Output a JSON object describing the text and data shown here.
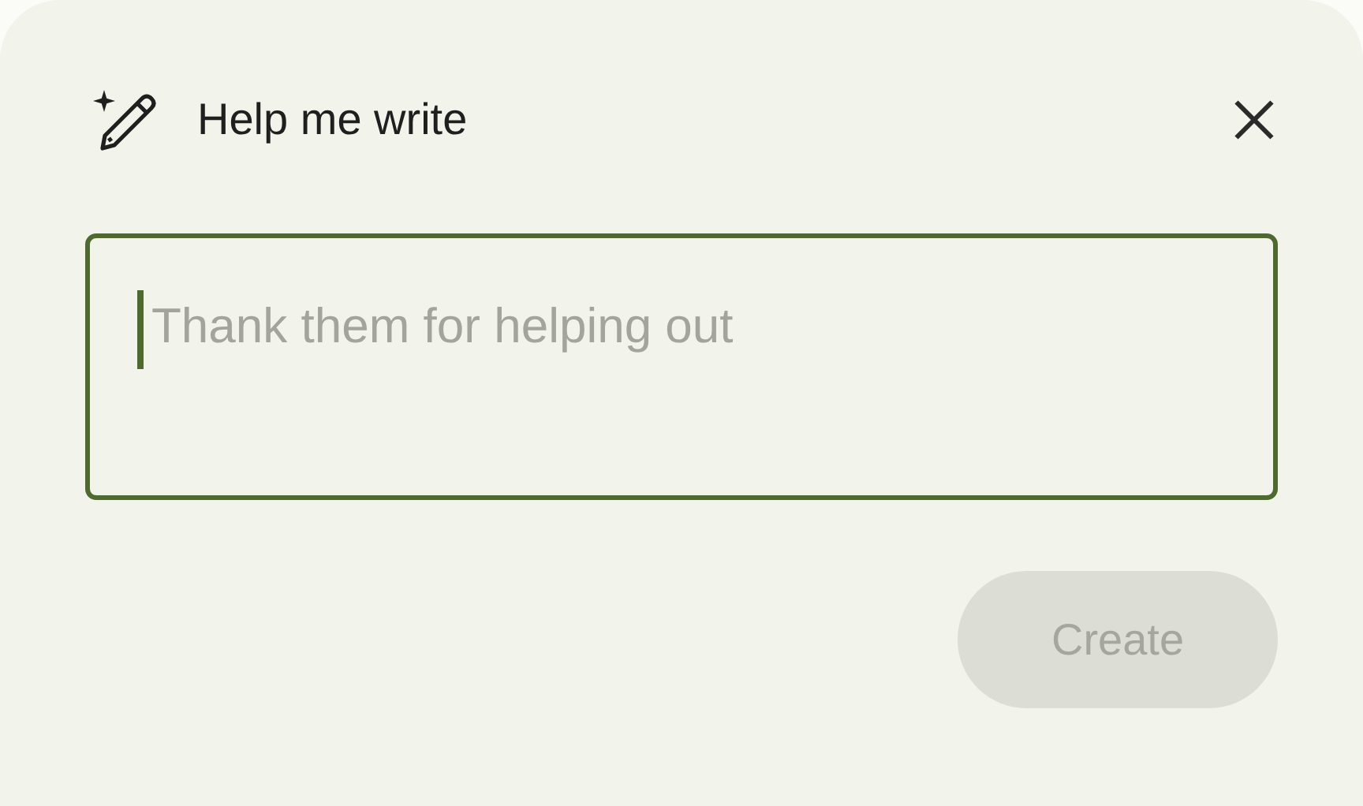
{
  "dialog": {
    "title": "Help me write"
  },
  "field": {
    "placeholder": "Thank them for helping out",
    "focused": true
  },
  "create_button": {
    "label": "Create",
    "disabled": true
  }
}
